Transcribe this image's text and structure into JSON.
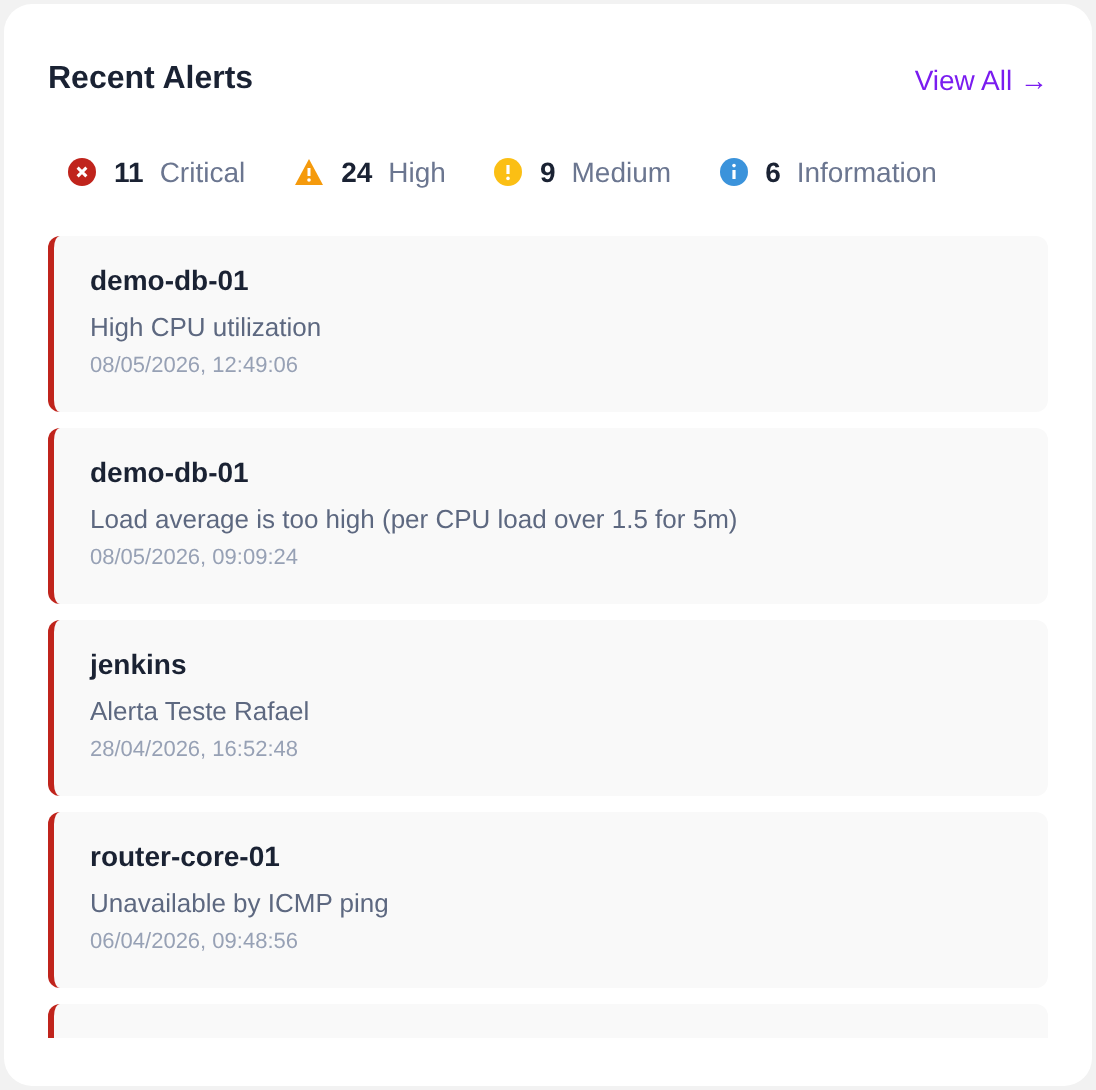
{
  "title": "Recent Alerts",
  "view_all": "View All →",
  "summary": [
    {
      "kind": "critical",
      "count": "11",
      "label": "Critical"
    },
    {
      "kind": "high",
      "count": "24",
      "label": "High"
    },
    {
      "kind": "medium",
      "count": "9",
      "label": "Medium"
    },
    {
      "kind": "information",
      "count": "6",
      "label": "Information"
    }
  ],
  "alerts": [
    {
      "kind": "critical",
      "host": "demo-db-01",
      "message": "High CPU utilization",
      "time": "08/05/2026, 12:49:06"
    },
    {
      "kind": "critical",
      "host": "demo-db-01",
      "message": "Load average is too high (per CPU load over 1.5 for 5m)",
      "time": "08/05/2026, 09:09:24"
    },
    {
      "kind": "critical",
      "host": "jenkins",
      "message": "Alerta Teste Rafael",
      "time": "28/04/2026, 16:52:48"
    },
    {
      "kind": "critical",
      "host": "router-core-01",
      "message": "Unavailable by ICMP ping",
      "time": "06/04/2026, 09:48:56"
    },
    {
      "kind": "critical"
    }
  ]
}
